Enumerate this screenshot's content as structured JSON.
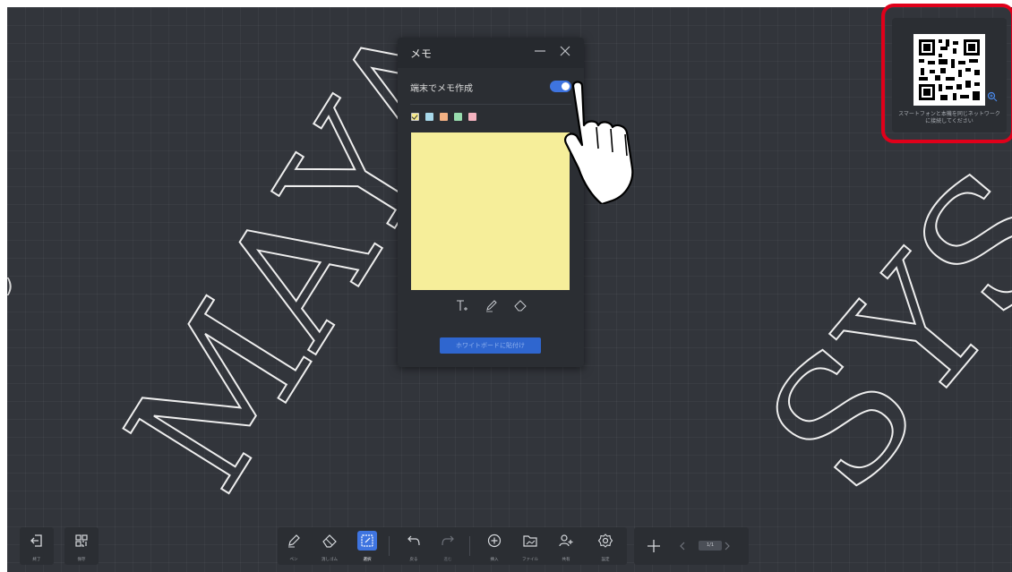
{
  "memo": {
    "title": "メモ",
    "toggle_label": "端末でメモ作成",
    "toggle_on": true,
    "colors": [
      "#f5e98c",
      "#a7d8ea",
      "#f4b183",
      "#98dcae",
      "#f4b2bf"
    ],
    "note_color": "#f6ee9a",
    "paste_button": "ホワイトボードに貼付け"
  },
  "qr": {
    "caption_line1": "スマートフォンと本機を同じネットワーク",
    "caption_line2": "に接続してください"
  },
  "watermark": {
    "text1": "MAYA",
    "text2": "SYS"
  },
  "toolbar": {
    "exit_label": "終了",
    "save_label": "保存",
    "pen_label": "ペン",
    "eraser_label": "消しゴム",
    "select_label": "選択",
    "undo_label": "戻る",
    "redo_label": "進む",
    "insert_label": "挿入",
    "file_label": "ファイル",
    "share_label": "共有",
    "settings_label": "設定",
    "page_indicator": "1/1"
  },
  "colors": {
    "board": "#32353b",
    "panel": "#2b2e33",
    "accent": "#3e74e0",
    "highlight": "#e0001a"
  }
}
